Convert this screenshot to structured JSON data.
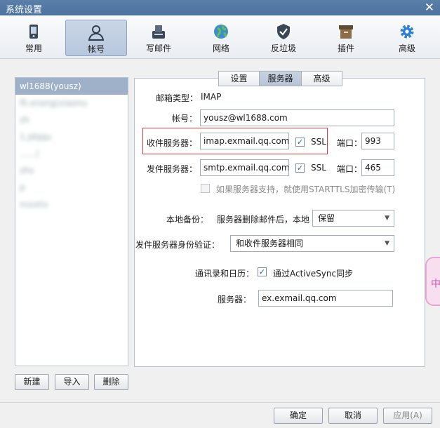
{
  "window": {
    "title": "系统设置",
    "close_glyph": "✕"
  },
  "toolbar": {
    "items": [
      {
        "label": "常用",
        "icon": "device-icon"
      },
      {
        "label": "帐号",
        "icon": "user-icon"
      },
      {
        "label": "写邮件",
        "icon": "compose-icon"
      },
      {
        "label": "网络",
        "icon": "globe-icon"
      },
      {
        "label": "反垃圾",
        "icon": "shield-icon"
      },
      {
        "label": "插件",
        "icon": "box-icon"
      },
      {
        "label": "高级",
        "icon": "gear-icon"
      }
    ],
    "active": "帐号"
  },
  "accounts": {
    "items": [
      {
        "label": "wl1688(yousz)"
      },
      {
        "label": "fli.snong(xiaonu"
      },
      {
        "label": "zh"
      },
      {
        "label": "1.jdqqu"
      },
      {
        "label": "......)"
      },
      {
        "label": "zhs"
      },
      {
        "label": "p"
      },
      {
        "label": "vuuxiu"
      }
    ],
    "buttons": {
      "new": "新建",
      "import": "导入",
      "delete": "删除"
    }
  },
  "tabs": [
    {
      "label": "设置"
    },
    {
      "label": "服务器"
    },
    {
      "label": "高级"
    }
  ],
  "form": {
    "mailbox_type": {
      "label": "邮箱类型：",
      "value": "IMAP"
    },
    "account": {
      "label": "帐号：",
      "value": "yousz@wl1688.com"
    },
    "incoming": {
      "label": "收件服务器：",
      "value": "imap.exmail.qq.com",
      "ssl_label": "SSL",
      "ssl_checked": true,
      "port_label": "端口：",
      "port": "993"
    },
    "outgoing": {
      "label": "发件服务器：",
      "value": "smtp.exmail.qq.com",
      "ssl_label": "SSL",
      "ssl_checked": true,
      "port_label": "端口：",
      "port": "465"
    },
    "starttls": {
      "label": "如果服务器支持，就使用STARTTLS加密传输(T)",
      "checked": false,
      "enabled": false
    },
    "backup": {
      "label": "本地备份：",
      "prefix": "服务器删除邮件后，本地",
      "selected": "保留"
    },
    "auth": {
      "label": "发件服务器身份验证：",
      "selected": "和收件服务器相同"
    },
    "contacts": {
      "label": "通讯录和日历：",
      "checkbox_label": "通过ActiveSync同步",
      "checked": true
    },
    "server": {
      "label": "服务器：",
      "value": "ex.exmail.qq.com"
    }
  },
  "footer": {
    "ok": "确定",
    "cancel": "取消",
    "apply": "应用(A)"
  },
  "side_widget": {
    "glyph": "中"
  },
  "colors": {
    "highlight": "#e03b3b",
    "selected_row": "#9fb1c8",
    "checkbox_check": "#1c5fb5"
  }
}
